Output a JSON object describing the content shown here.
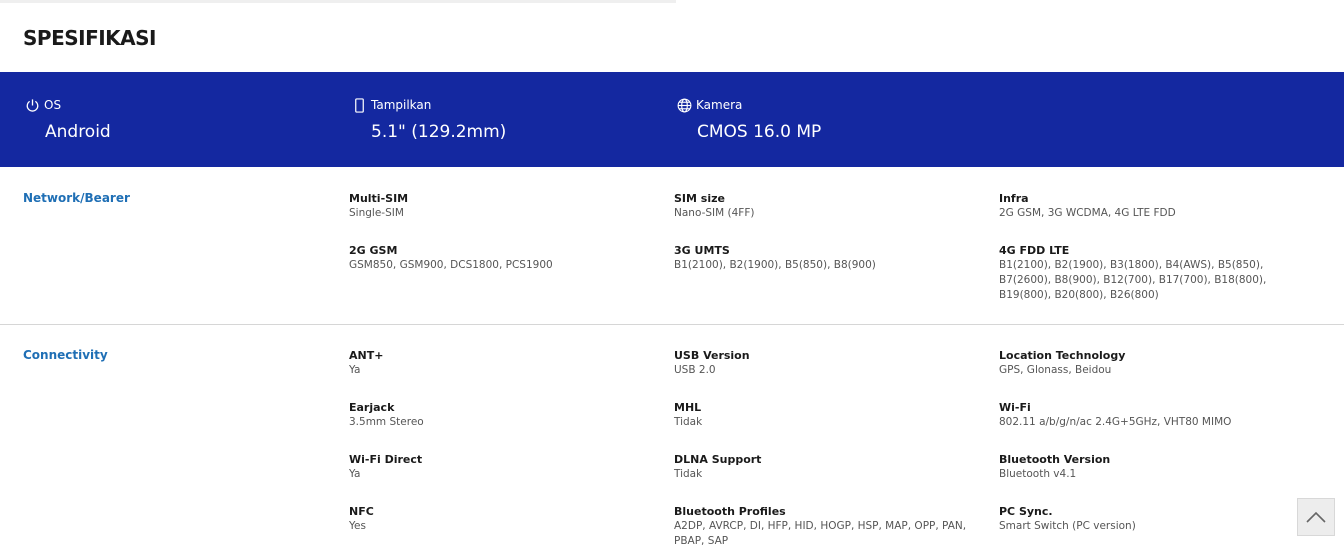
{
  "page": {
    "title": "SPESIFIKASI"
  },
  "highlights": [
    {
      "icon": "power-icon",
      "label": "OS",
      "value": "Android"
    },
    {
      "icon": "phone-icon",
      "label": "Tampilkan",
      "value": "5.1\" (129.2mm)"
    },
    {
      "icon": "globe-icon",
      "label": "Kamera",
      "value": "CMOS 16.0 MP"
    }
  ],
  "sections": [
    {
      "title": "Network/Bearer",
      "specs": [
        {
          "key": "Multi-SIM",
          "value": "Single-SIM"
        },
        {
          "key": "SIM size",
          "value": "Nano-SIM (4FF)"
        },
        {
          "key": "Infra",
          "value": "2G GSM, 3G WCDMA, 4G LTE FDD"
        },
        {
          "key": "2G GSM",
          "value": "GSM850, GSM900, DCS1800, PCS1900"
        },
        {
          "key": "3G UMTS",
          "value": "B1(2100), B2(1900), B5(850), B8(900)"
        },
        {
          "key": "4G FDD LTE",
          "value": "B1(2100), B2(1900), B3(1800), B4(AWS), B5(850), B7(2600), B8(900), B12(700), B17(700), B18(800), B19(800), B20(800), B26(800)"
        }
      ]
    },
    {
      "title": "Connectivity",
      "specs": [
        {
          "key": "ANT+",
          "value": "Ya"
        },
        {
          "key": "USB Version",
          "value": "USB 2.0"
        },
        {
          "key": "Location Technology",
          "value": "GPS, Glonass, Beidou"
        },
        {
          "key": "Earjack",
          "value": "3.5mm Stereo"
        },
        {
          "key": "MHL",
          "value": "Tidak"
        },
        {
          "key": "Wi-Fi",
          "value": "802.11 a/b/g/n/ac 2.4G+5GHz, VHT80 MIMO"
        },
        {
          "key": "Wi-Fi Direct",
          "value": "Ya"
        },
        {
          "key": "DLNA Support",
          "value": "Tidak"
        },
        {
          "key": "Bluetooth Version",
          "value": "Bluetooth v4.1"
        },
        {
          "key": "NFC",
          "value": "Yes"
        },
        {
          "key": "Bluetooth Profiles",
          "value": "A2DP, AVRCP, DI, HFP, HID, HOGP, HSP, MAP, OPP, PAN, PBAP, SAP"
        },
        {
          "key": "PC Sync.",
          "value": "Smart Switch (PC version)"
        }
      ]
    }
  ],
  "colors": {
    "accent": "#1428a0",
    "section_title": "#1f6fb5"
  },
  "scroll_top": {
    "icon": "chevron-up-icon"
  }
}
